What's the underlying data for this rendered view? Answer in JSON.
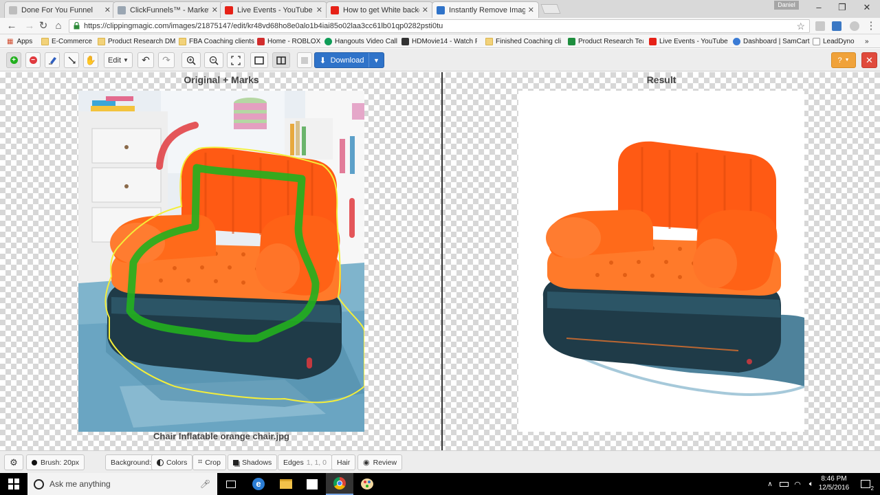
{
  "browser": {
    "tabs": [
      {
        "label": "Done For You Funnel",
        "icon_color": "#bdbdbd"
      },
      {
        "label": "ClickFunnels™ - Marketi",
        "icon_color": "#9aa6b2"
      },
      {
        "label": "Live Events - YouTube",
        "icon_color": "#e62117"
      },
      {
        "label": "How to get White backg",
        "icon_color": "#e62117"
      },
      {
        "label": "Instantly Remove Image",
        "icon_color": "#2f73c9"
      }
    ],
    "profile_name": "Daniel",
    "url": "https://clippingmagic.com/images/21875147/edit/kr48vd68ho8e0alo1b4iai85o02laa3cc61lb01qp0282psti0tu"
  },
  "bookmarks": [
    {
      "label": "Apps",
      "icon": "apps-grid-icon"
    },
    {
      "label": "E-Commerce",
      "icon": "folder-icon"
    },
    {
      "label": "Product Research DM",
      "icon": "folder-icon"
    },
    {
      "label": "FBA Coaching clients",
      "icon": "folder-icon"
    },
    {
      "label": "Home - ROBLOX",
      "icon": "roblox-icon"
    },
    {
      "label": "Hangouts Video Call",
      "icon": "hangouts-icon"
    },
    {
      "label": "HDMovie14 - Watch F",
      "icon": "movie-icon"
    },
    {
      "label": "Finished Coaching cli",
      "icon": "folder-icon"
    },
    {
      "label": "Product Research Tea",
      "icon": "sheets-icon"
    },
    {
      "label": "Live Events - YouTube",
      "icon": "youtube-icon"
    },
    {
      "label": "Dashboard | SamCart",
      "icon": "samcart-icon"
    },
    {
      "label": "LeadDyno",
      "icon": "page-icon"
    }
  ],
  "toolbar": {
    "edit_label": "Edit",
    "download_label": "Download",
    "help_label": "?"
  },
  "panels": {
    "left_title": "Original + Marks",
    "right_title": "Result",
    "filename": "Chair Inflatable orange chair.jpg"
  },
  "bottom": {
    "brush_label": "Brush: 20px",
    "background_label": "Background:",
    "colors_label": "Colors",
    "crop_label": "Crop",
    "shadows_label": "Shadows",
    "edges_label": "Edges",
    "edges_values": "1, 1, 0",
    "hair_label": "Hair",
    "review_label": "Review"
  },
  "taskbar": {
    "search_placeholder": "Ask me anything",
    "time": "8:46 PM",
    "date": "12/5/2016",
    "notification_count": "2"
  },
  "colors": {
    "keep_mark": "#22b01e",
    "remove_mark": "#e0393e",
    "edge_outline": "#f4ee3a",
    "chair_orange": "#ff6a1a",
    "chair_base": "#1f3b48",
    "download_blue": "#2f73c9",
    "help_orange": "#f0a23a",
    "close_red": "#e04a3c"
  }
}
